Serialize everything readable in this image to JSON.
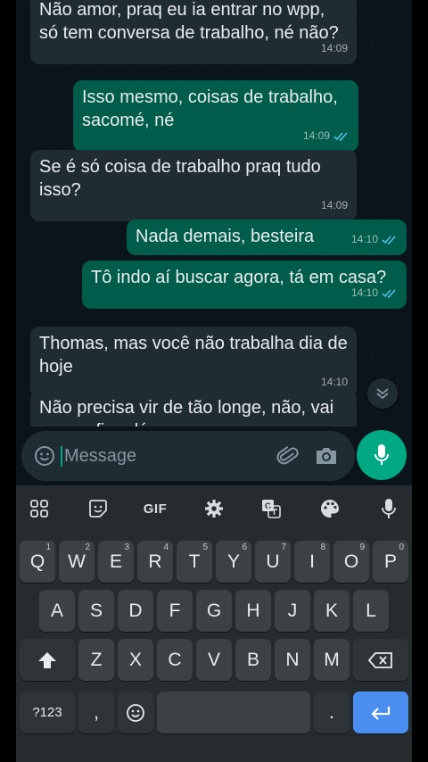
{
  "messages": [
    {
      "text": "Não amor, praq eu ia entrar no wpp, só tem conversa de trabalho, né não?",
      "time": "14:09"
    },
    {
      "text": "Isso mesmo, coisas de trabalho, sacomé, né",
      "time": "14:09"
    },
    {
      "text": "Se é só coisa de trabalho praq tudo isso?",
      "time": "14:09"
    },
    {
      "text": "Nada demais, besteira",
      "time": "14:10"
    },
    {
      "text": "Tô indo aí buscar agora, tá em casa?",
      "time": "14:10"
    },
    {
      "text": "Thomas, mas você não trabalha dia de hoje",
      "time": "14:10"
    },
    {
      "text": "Não precisa vir de tão longe, não, vai querer ficar lá..."
    }
  ],
  "composer": {
    "placeholder": "Message"
  },
  "keyboard": {
    "toolbar": {
      "gif": "GIF"
    },
    "row1": [
      {
        "label": "Q",
        "hint": "1"
      },
      {
        "label": "W",
        "hint": "2"
      },
      {
        "label": "E",
        "hint": "3"
      },
      {
        "label": "R",
        "hint": "4"
      },
      {
        "label": "T",
        "hint": "5"
      },
      {
        "label": "Y",
        "hint": "6"
      },
      {
        "label": "U",
        "hint": "7"
      },
      {
        "label": "I",
        "hint": "8"
      },
      {
        "label": "O",
        "hint": "9"
      },
      {
        "label": "P",
        "hint": "0"
      }
    ],
    "row2": [
      "A",
      "S",
      "D",
      "F",
      "G",
      "H",
      "J",
      "K",
      "L"
    ],
    "row3": [
      "Z",
      "X",
      "C",
      "V",
      "B",
      "N",
      "M"
    ],
    "row4": {
      "symbols": "?123",
      "comma": ",",
      "period": "."
    }
  },
  "colors": {
    "incoming": "#1f2c34",
    "outgoing": "#005c4b",
    "accent": "#00a884",
    "ticks": "#53bdeb"
  },
  "icons": [
    "chevron-down-icon",
    "emoji-icon",
    "paperclip-icon",
    "camera-icon",
    "mic-icon",
    "grid-icon",
    "sticker-icon",
    "gear-icon",
    "translate-icon",
    "palette-icon",
    "shift-icon",
    "backspace-icon",
    "enter-icon"
  ]
}
